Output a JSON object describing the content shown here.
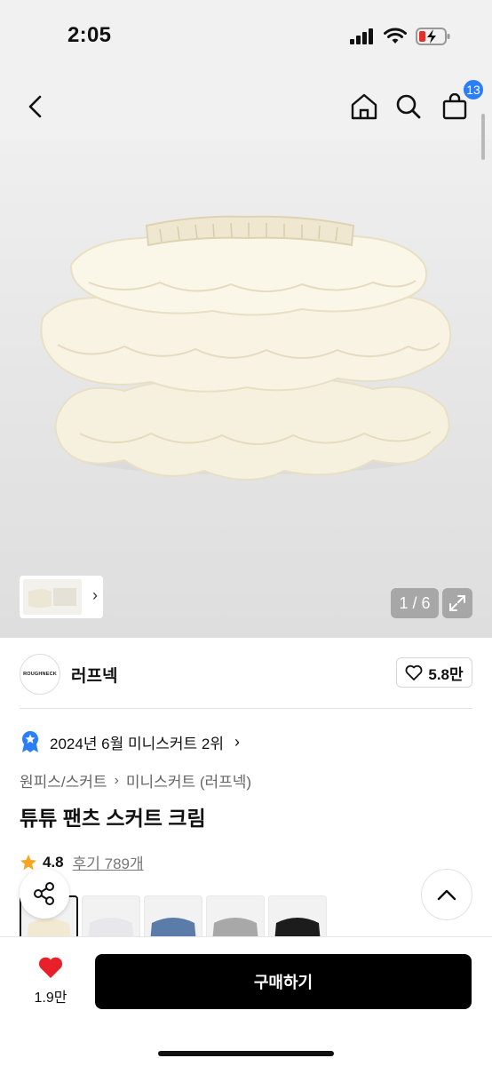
{
  "status": {
    "time": "2:05"
  },
  "header": {
    "cart_count": "13"
  },
  "gallery": {
    "counter": "1 / 6"
  },
  "brand": {
    "logo_text": "ROUGHNECK",
    "name": "러프넥",
    "likes": "5.8만"
  },
  "ranking": {
    "text": "2024년 6월 미니스커트 2위"
  },
  "breadcrumb": {
    "items": [
      "원피스/스커트",
      "미니스커트 (러프넥)"
    ]
  },
  "product": {
    "title": "튜튜 팬츠 스커트 크림",
    "rating": "4.8",
    "reviews": "후기 789개"
  },
  "swatches": [
    {
      "color": "#f3ecd9",
      "label": "cream"
    },
    {
      "color": "#f4f4f6",
      "label": "white"
    },
    {
      "color": "#5b7ba8",
      "label": "blue"
    },
    {
      "color": "#a8a8a8",
      "label": "gray"
    },
    {
      "color": "#1c1c1c",
      "label": "black"
    }
  ],
  "bottom_bar": {
    "wish_count": "1.9만",
    "buy_label": "구매하기"
  },
  "colors": {
    "accent_blue": "#2b7ef6",
    "heart_red": "#e8202a",
    "star_orange": "#f5a623",
    "buy_black": "#000000"
  }
}
